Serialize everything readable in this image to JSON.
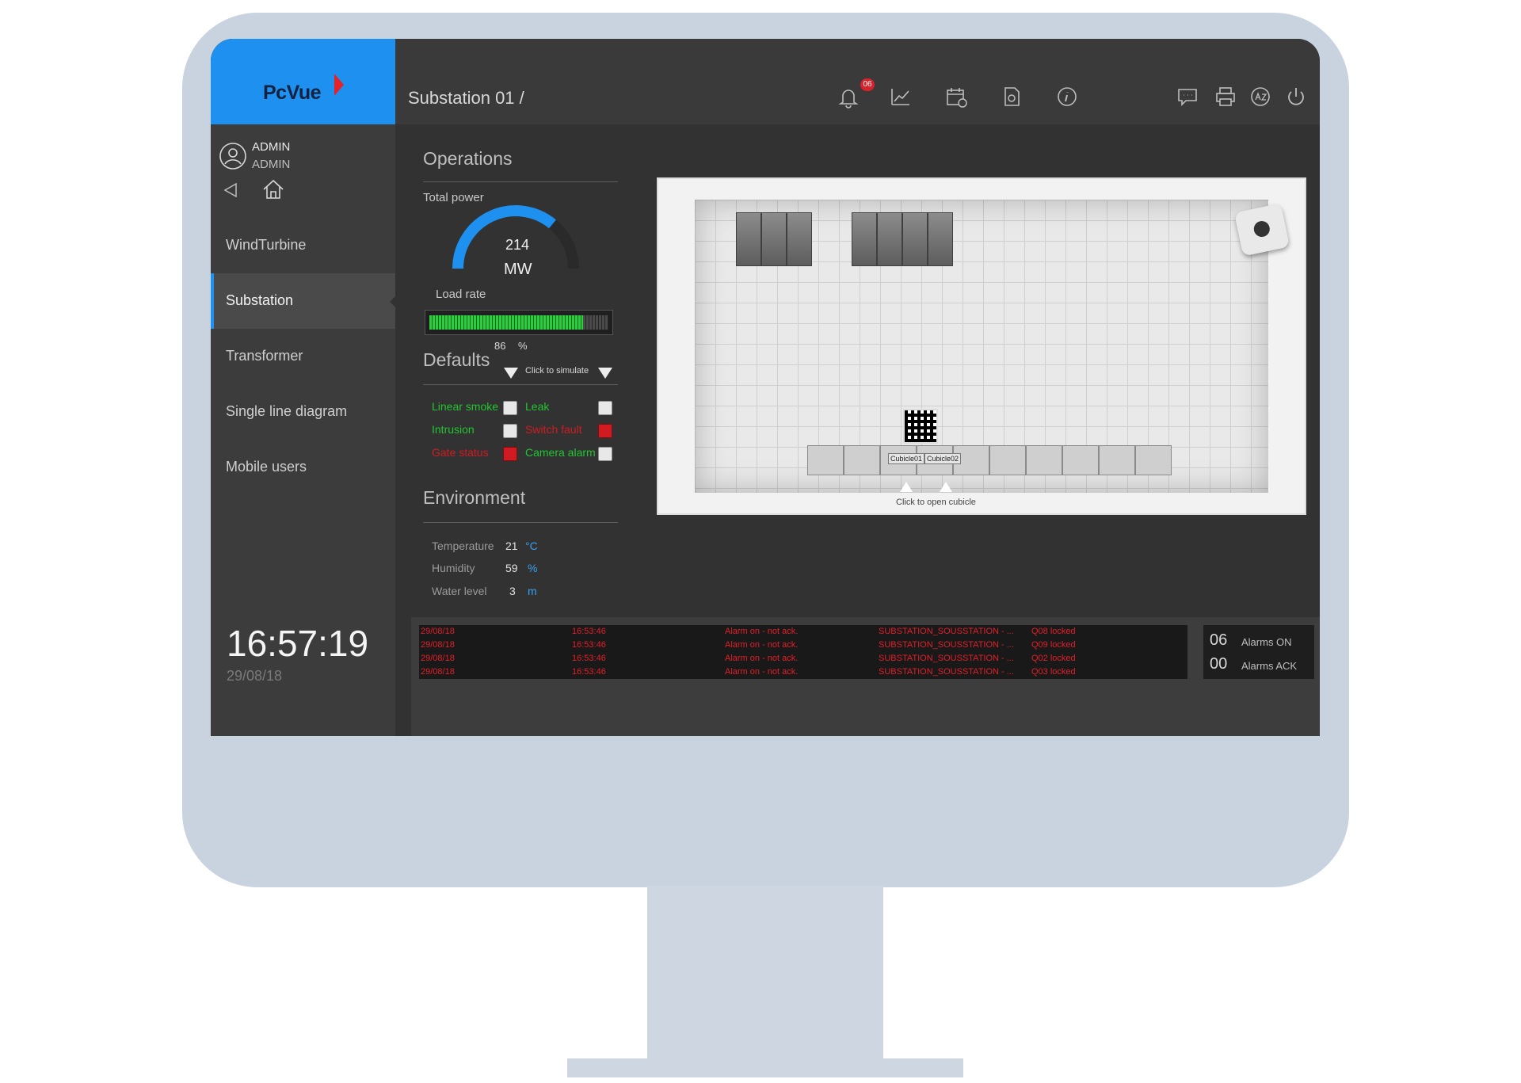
{
  "app": {
    "logo": "PcVue",
    "breadcrumb": "Substation 01 /"
  },
  "toolbar": {
    "alarm_badge": "06",
    "icons": [
      "bell-icon",
      "trend-chart-icon",
      "schedule-icon",
      "report-icon",
      "info-icon",
      "chat-icon",
      "print-icon",
      "language-icon",
      "power-icon"
    ]
  },
  "user": {
    "name": "ADMIN",
    "role": "ADMIN"
  },
  "sidebar": {
    "items": [
      {
        "label": "WindTurbine",
        "active": false
      },
      {
        "label": "Substation",
        "active": true
      },
      {
        "label": "Transformer",
        "active": false
      },
      {
        "label": "Single line diagram",
        "active": false
      },
      {
        "label": "Mobile users",
        "active": false
      }
    ]
  },
  "clock": {
    "time": "16:57:19",
    "date": "29/08/18"
  },
  "operations": {
    "title": "Operations",
    "total_power_label": "Total power",
    "total_power_value": "214",
    "total_power_unit": "MW",
    "total_power_fraction": 0.72,
    "load_rate_label": "Load rate",
    "load_rate_value": "86",
    "load_rate_unit": "%"
  },
  "defaults": {
    "title": "Defaults",
    "simulate_hint": "Click to simulate",
    "items": [
      {
        "label": "Linear smoke",
        "color": "#21c531",
        "active": false
      },
      {
        "label": "Leak",
        "color": "#21c531",
        "active": false
      },
      {
        "label": "Intrusion",
        "color": "#21c531",
        "active": false
      },
      {
        "label": "Switch fault",
        "color": "#d11b22",
        "active": true
      },
      {
        "label": "Gate status",
        "color": "#d11b22",
        "active": true
      },
      {
        "label": "Camera alarm",
        "color": "#21c531",
        "active": false
      }
    ]
  },
  "environment": {
    "title": "Environment",
    "rows": [
      {
        "label": "Temperature",
        "value": "21",
        "unit": "°C"
      },
      {
        "label": "Humidity",
        "value": "59",
        "unit": "%"
      },
      {
        "label": "Water level",
        "value": "3",
        "unit": "m"
      }
    ]
  },
  "view": {
    "cubicle1": "Cubicle01",
    "cubicle2": "Cubicle02",
    "hint": "Click to open cubicle"
  },
  "alarms": {
    "rows": [
      {
        "date": "29/08/18",
        "time": "16:53:46",
        "status": "Alarm on - not ack.",
        "source": "SUBSTATION_SOUSSTATION - ...",
        "msg": "Q08 locked"
      },
      {
        "date": "29/08/18",
        "time": "16:53:46",
        "status": "Alarm on - not ack.",
        "source": "SUBSTATION_SOUSSTATION - ...",
        "msg": "Q09 locked"
      },
      {
        "date": "29/08/18",
        "time": "16:53:46",
        "status": "Alarm on - not ack.",
        "source": "SUBSTATION_SOUSSTATION - ...",
        "msg": "Q02 locked"
      },
      {
        "date": "29/08/18",
        "time": "16:53:46",
        "status": "Alarm on - not ack.",
        "source": "SUBSTATION_SOUSSTATION - ...",
        "msg": "Q03 locked"
      }
    ],
    "on_count": "06",
    "on_label": "Alarms ON",
    "ack_count": "00",
    "ack_label": "Alarms ACK"
  },
  "colors": {
    "accent": "#1e90ef",
    "alarm": "#e0202a",
    "ok": "#21c531",
    "gauge": "#1e90ef"
  }
}
